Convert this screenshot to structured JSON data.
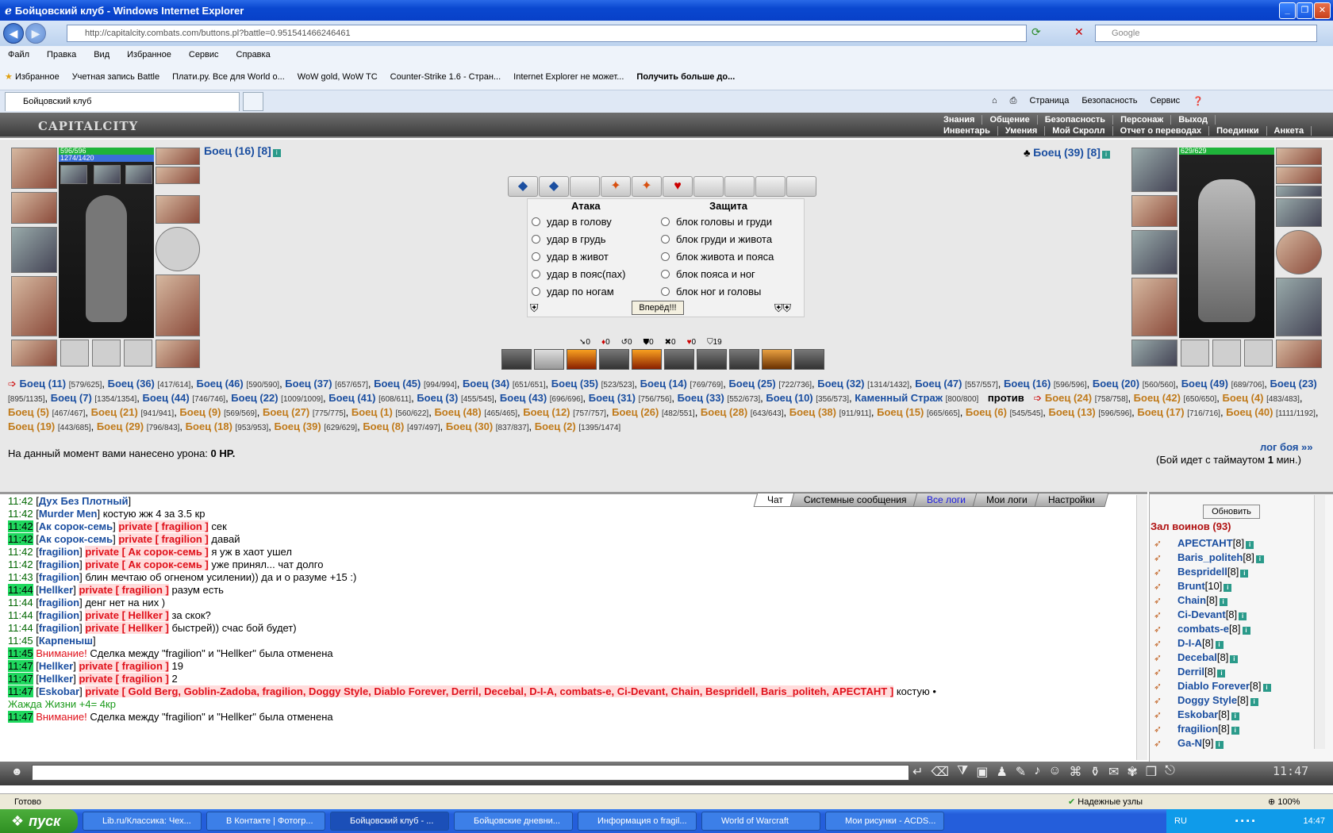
{
  "window": {
    "title": "Бойцовский клуб - Windows Internet Explorer"
  },
  "browser": {
    "url": "http://capitalcity.combats.com/buttons.pl?battle=0.951541466246461",
    "search_placeholder": "Google",
    "menu": [
      "Файл",
      "Правка",
      "Вид",
      "Избранное",
      "Сервис",
      "Справка"
    ],
    "favorites_label": "Избранное",
    "favorites": [
      "Учетная запись Battle",
      "Плати.ру. Все для World о...",
      "WoW gold, WoW TC",
      "Counter-Strike 1.6 - Стран...",
      "Internet Explorer не может...",
      "Получить больше до..."
    ],
    "tab_title": "Бойцовский клуб",
    "tools": [
      "Страница",
      "Безопасность",
      "Сервис"
    ]
  },
  "game": {
    "logo": "CAPITALCITY",
    "nav_top": [
      "Знания",
      "Общение",
      "Безопасность",
      "Персонаж",
      "Выход"
    ],
    "nav_bottom": [
      "Инвентарь",
      "Умения",
      "Мой Скролл",
      "Отчет о переводах",
      "Поединки",
      "Анкета"
    ],
    "left_fighter": {
      "name": "Боец (16) [8]",
      "hp": "596/596",
      "mp": "1274/1420"
    },
    "right_fighter": {
      "name": "Боец (39) [8]",
      "hp": "629/629"
    },
    "attack_header": "Атака",
    "defense_header": "Защита",
    "attacks": [
      "удар в голову",
      "удар в грудь",
      "удар в живот",
      "удар в пояс(пах)",
      "удар по ногам"
    ],
    "blocks": [
      "блок головы и груди",
      "блок груди и живота",
      "блок живота и пояса",
      "блок пояса и ног",
      "блок ног и головы"
    ],
    "go_button": "Вперёд!!!",
    "counters": [
      "0",
      "0",
      "0",
      "0",
      "0",
      "0",
      "19"
    ],
    "vs": "против",
    "damage_label": "На данный момент вами нанесено урона:",
    "damage_value": "0 HP.",
    "log_link": "лог боя »»",
    "timeout_text": "(Бой идет с таймаутом",
    "timeout_value": "1",
    "timeout_unit": "мин.)"
  },
  "team_blue": [
    {
      "n": "Боец (11)",
      "hp": "[579/625]"
    },
    {
      "n": "Боец (36)",
      "hp": "[417/614]"
    },
    {
      "n": "Боец (46)",
      "hp": "[590/590]"
    },
    {
      "n": "Боец (37)",
      "hp": "[657/657]"
    },
    {
      "n": "Боец (45)",
      "hp": "[994/994]"
    },
    {
      "n": "Боец (34)",
      "hp": "[651/651]"
    },
    {
      "n": "Боец (35)",
      "hp": "[523/523]"
    },
    {
      "n": "Боец (14)",
      "hp": "[769/769]"
    },
    {
      "n": "Боец (25)",
      "hp": "[722/736]"
    },
    {
      "n": "Боец (32)",
      "hp": "[1314/1432]"
    },
    {
      "n": "Боец (47)",
      "hp": "[557/557]"
    },
    {
      "n": "Боец (16)",
      "hp": "[596/596]"
    },
    {
      "n": "Боец (20)",
      "hp": "[560/560]"
    },
    {
      "n": "Боец (49)",
      "hp": "[689/706]"
    },
    {
      "n": "Боец (23)",
      "hp": "[895/1135]"
    },
    {
      "n": "Боец (7)",
      "hp": "[1354/1354]"
    },
    {
      "n": "Боец (44)",
      "hp": "[746/746]"
    },
    {
      "n": "Боец (22)",
      "hp": "[1009/1009]"
    },
    {
      "n": "Боец (41)",
      "hp": "[608/611]"
    },
    {
      "n": "Боец (3)",
      "hp": "[455/545]"
    },
    {
      "n": "Боец (43)",
      "hp": "[696/696]"
    },
    {
      "n": "Боец (31)",
      "hp": "[756/756]"
    },
    {
      "n": "Боец (33)",
      "hp": "[552/673]"
    },
    {
      "n": "Боец (10)",
      "hp": "[356/573]"
    },
    {
      "n": "Каменный Страж",
      "hp": "[800/800]"
    }
  ],
  "team_orange": [
    {
      "n": "Боец (24)",
      "hp": "[758/758]"
    },
    {
      "n": "Боец (42)",
      "hp": "[650/650]"
    },
    {
      "n": "Боец (4)",
      "hp": "[483/483]"
    },
    {
      "n": "Боец (5)",
      "hp": "[467/467]"
    },
    {
      "n": "Боец (21)",
      "hp": "[941/941]"
    },
    {
      "n": "Боец (9)",
      "hp": "[569/569]"
    },
    {
      "n": "Боец (27)",
      "hp": "[775/775]"
    },
    {
      "n": "Боец (1)",
      "hp": "[560/622]"
    },
    {
      "n": "Боец (48)",
      "hp": "[465/465]"
    },
    {
      "n": "Боец (12)",
      "hp": "[757/757]"
    },
    {
      "n": "Боец (26)",
      "hp": "[482/551]"
    },
    {
      "n": "Боец (28)",
      "hp": "[643/643]"
    },
    {
      "n": "Боец (38)",
      "hp": "[911/911]"
    },
    {
      "n": "Боец (15)",
      "hp": "[665/665]"
    },
    {
      "n": "Боец (6)",
      "hp": "[545/545]"
    },
    {
      "n": "Боец (13)",
      "hp": "[596/596]"
    },
    {
      "n": "Боец (17)",
      "hp": "[716/716]"
    },
    {
      "n": "Боец (40)",
      "hp": "[1111/1192]"
    },
    {
      "n": "Боец (19)",
      "hp": "[443/685]"
    },
    {
      "n": "Боец (29)",
      "hp": "[796/843]"
    },
    {
      "n": "Боец (18)",
      "hp": "[953/953]"
    },
    {
      "n": "Боец (39)",
      "hp": "[629/629]"
    },
    {
      "n": "Боец (8)",
      "hp": "[497/497]"
    },
    {
      "n": "Боец (30)",
      "hp": "[837/837]"
    },
    {
      "n": "Боец (2)",
      "hp": "[1395/1474]"
    }
  ],
  "chat": {
    "tabs": [
      "Чат",
      "Системные сообщения",
      "Все логи",
      "Мои логи",
      "Настройки"
    ],
    "messages": [
      {
        "t": "11:42",
        "hl": false,
        "nick": "Дух Без Плотный",
        "priv": "",
        "text": ""
      },
      {
        "t": "11:42",
        "hl": false,
        "nick": "Murder Men",
        "priv": "",
        "text": "костую жж 4 за 3.5 кр"
      },
      {
        "t": "11:42",
        "hl": true,
        "nick": "Ак сорок-семь",
        "priv": "private [ fragilion ]",
        "text": "сек"
      },
      {
        "t": "11:42",
        "hl": true,
        "nick": "Ак сорок-семь",
        "priv": "private [ fragilion ]",
        "text": "давай"
      },
      {
        "t": "11:42",
        "hl": false,
        "nick": "fragilion",
        "priv": "private [ Ак сорок-семь ]",
        "text": "я уж в хаот ушел"
      },
      {
        "t": "11:42",
        "hl": false,
        "nick": "fragilion",
        "priv": "private [ Ак сорок-семь ]",
        "text": "уже принял... чат долго"
      },
      {
        "t": "11:43",
        "hl": false,
        "nick": "fragilion",
        "priv": "",
        "text": "блин мечтаю об огненом усилении)) да и о разуме +15 :)"
      },
      {
        "t": "11:44",
        "hl": true,
        "nick": "Hellker",
        "priv": "private [ fragilion ]",
        "text": "разум есть"
      },
      {
        "t": "11:44",
        "hl": false,
        "nick": "fragilion",
        "priv": "",
        "text": "денг нет на них )"
      },
      {
        "t": "11:44",
        "hl": false,
        "nick": "fragilion",
        "priv": "private [ Hellker ]",
        "text": "за скок?"
      },
      {
        "t": "11:44",
        "hl": false,
        "nick": "fragilion",
        "priv": "private [ Hellker ]",
        "text": "быстрей)) счас бой будет)"
      },
      {
        "t": "11:45",
        "hl": false,
        "nick": "Карпеныш",
        "priv": "",
        "text": ""
      },
      {
        "t": "11:45",
        "hl": true,
        "nick": "",
        "priv": "",
        "warn": "Внимание!",
        "text": "Сделка между \"fragilion\" и \"Hellker\" была отменена"
      },
      {
        "t": "11:47",
        "hl": true,
        "nick": "Hellker",
        "priv": "private [ fragilion ]",
        "text": "19"
      },
      {
        "t": "11:47",
        "hl": true,
        "nick": "Hellker",
        "priv": "private [ fragilion ]",
        "text": "2"
      },
      {
        "t": "11:47",
        "hl": true,
        "nick": "Eskobar",
        "priv": "private [ Gold Berg, Goblin-Zadoba, fragilion, Doggy Style, Diablo Forever, Derril, Decebal, D-I-A, combats-e, Ci-Devant, Chain, Bespridell, Baris_politeh, АРЕСТАНТ ]",
        "text": "костую •"
      },
      {
        "t": "",
        "hl": false,
        "nick": "",
        "priv": "",
        "text": "Жажда Жизни +4= 4кр"
      },
      {
        "t": "11:47",
        "hl": true,
        "nick": "",
        "priv": "",
        "warn": "Внимание!",
        "text": "Сделка между \"fragilion\" и \"Hellker\" была отменена"
      }
    ]
  },
  "room": {
    "refresh": "Обновить",
    "title": "Зал воинов (93)",
    "users": [
      {
        "n": "АРЕСТАНТ",
        "lv": "[8]"
      },
      {
        "n": "Baris_politeh",
        "lv": "[8]"
      },
      {
        "n": "Bespridell",
        "lv": "[8]"
      },
      {
        "n": "Brunt",
        "lv": "[10]"
      },
      {
        "n": "Chain",
        "lv": "[8]"
      },
      {
        "n": "Ci-Devant",
        "lv": "[8]"
      },
      {
        "n": "combats-e",
        "lv": "[8]"
      },
      {
        "n": "D-I-A",
        "lv": "[8]"
      },
      {
        "n": "Decebal",
        "lv": "[8]"
      },
      {
        "n": "Derril",
        "lv": "[8]"
      },
      {
        "n": "Diablo Forever",
        "lv": "[8]"
      },
      {
        "n": "Doggy Style",
        "lv": "[8]"
      },
      {
        "n": "Eskobar",
        "lv": "[8]"
      },
      {
        "n": "fragilion",
        "lv": "[8]"
      },
      {
        "n": "Ga-N",
        "lv": "[9]"
      }
    ]
  },
  "clock": "11:47",
  "status": {
    "left": "Готово",
    "zone": "Надежные узлы",
    "zoom": "100%"
  },
  "taskbar": {
    "start": "пуск",
    "items": [
      "Lib.ru/Классика: Чех...",
      "В Контакте | Фотогр...",
      "Бойцовский клуб - ...",
      "Бойцовские дневни...",
      "Информация о fragil...",
      "World of Warcraft",
      "Мои рисунки - ACDS..."
    ],
    "lang": "RU",
    "time": "14:47"
  }
}
